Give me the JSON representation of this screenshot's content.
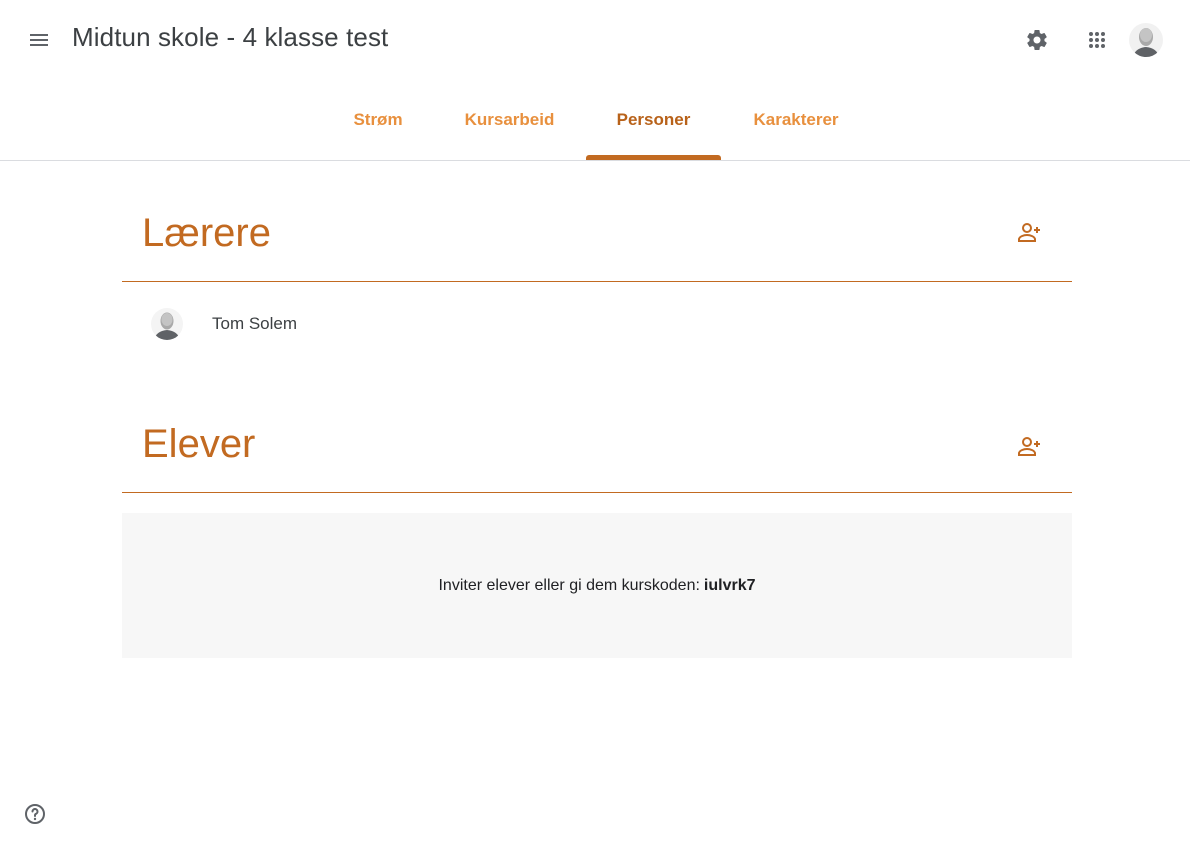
{
  "header": {
    "class_title": "Midtun skole - 4 klasse test",
    "icons": {
      "menu": "menu-icon",
      "settings": "gear-icon",
      "apps": "apps-grid-icon",
      "account": "account-avatar"
    }
  },
  "tabs": [
    {
      "label": "Strøm",
      "active": false
    },
    {
      "label": "Kursarbeid",
      "active": false
    },
    {
      "label": "Personer",
      "active": true
    },
    {
      "label": "Karakterer",
      "active": false
    }
  ],
  "teachers": {
    "title": "Lærere",
    "people": [
      {
        "name": "Tom Solem"
      }
    ]
  },
  "students": {
    "title": "Elever",
    "invite_text": "Inviter elever eller gi dem kurskoden:",
    "class_code": "iulvrk7"
  },
  "colors": {
    "accent": "#c26a21",
    "tab_inactive": "#e8903e",
    "tab_active": "#b8621a"
  }
}
